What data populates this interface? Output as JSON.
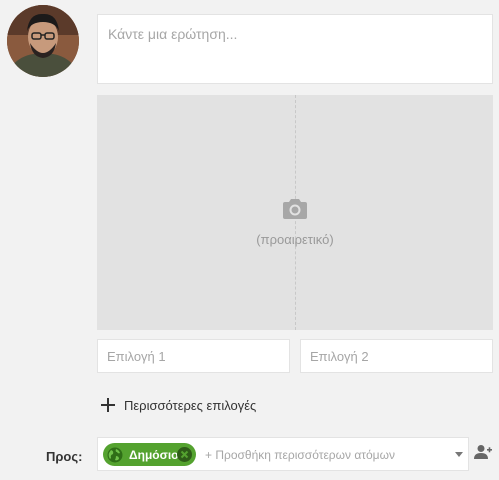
{
  "post": {
    "question_placeholder": "Κάντε μια ερώτηση...",
    "photo_optional_label": "(προαιρετικό)",
    "option_1_placeholder": "Επιλογή 1",
    "option_2_placeholder": "Επιλογή 2",
    "more_options_label": "Περισσότερες επιλογές"
  },
  "audience": {
    "to_label": "Προς:",
    "chip_label": "Δημόσιο",
    "add_people_placeholder": "+ Προσθήκη περισσότερων ατόμων"
  },
  "colors": {
    "chip_background": "#54a22f",
    "page_background": "#f2f2f2"
  },
  "icons": [
    "avatar",
    "camera-icon",
    "plus-icon",
    "globe-icon",
    "close-icon",
    "dropdown-arrow-icon",
    "add-person-icon"
  ]
}
